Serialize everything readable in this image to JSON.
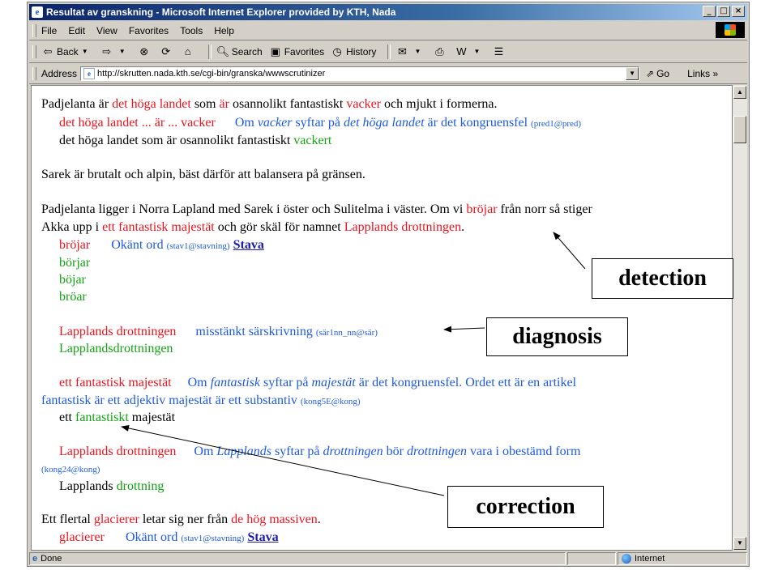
{
  "window": {
    "title": "Resultat av granskning - Microsoft Internet Explorer provided by KTH, Nada",
    "caption_buttons": [
      "_",
      "□",
      "×"
    ]
  },
  "menu": [
    "File",
    "Edit",
    "View",
    "Favorites",
    "Tools",
    "Help"
  ],
  "toolbar": {
    "back": "Back",
    "search": "Search",
    "favorites": "Favorites",
    "history": "History"
  },
  "address": {
    "label": "Address",
    "url": "http://skrutten.nada.kth.se/cgi-bin/granska/wwwscrutinizer",
    "go": "Go",
    "links": "Links"
  },
  "content": {
    "p1": {
      "a": "Padjelanta är ",
      "b": "det höga landet",
      "c": " som ",
      "d": "är",
      "e": " osannolikt fantastiskt ",
      "f": "vacker",
      "g": " och mjukt i formerna."
    },
    "p1_err": {
      "phrase": "det höga landet ... är ... vacker",
      "m1": "Om ",
      "m2": "vacker",
      "m3": " syftar på ",
      "m4": "det höga landet",
      "m5": " är det kongruensfel ",
      "code": "(pred1@pred)"
    },
    "p1_corr": {
      "a": "det höga landet som är osannolikt fantastiskt ",
      "b": "vackert"
    },
    "p2": "Sarek är brutalt och alpin, bäst därför att balansera på gränsen.",
    "p3": {
      "l1a": "Padjelanta ligger i Norra Lapland med Sarek i öster och Sulitelma i väster. Om vi ",
      "l1b": "bröjar",
      "l1c": " från norr så stiger",
      "l2a": "Akka upp i ",
      "l2b": "ett fantastisk majestät",
      "l2c": " och gör skäl för namnet ",
      "l2d": "Lapplands drottningen",
      "l2e": "."
    },
    "err_brojar": {
      "word": "bröjar",
      "msg": "Okänt ord ",
      "code": "(stav1@stavning)",
      "link": "Stava",
      "suggestions": [
        "börjar",
        "böjar",
        "bröar"
      ]
    },
    "err_sar": {
      "phrase": "Lapplands drottningen",
      "msg": "misstänkt särskrivning ",
      "code": "(sär1nn_nn@sär)",
      "fix": "Lapplandsdrottningen"
    },
    "err_kong": {
      "phrase": "ett fantastisk majestät",
      "m1": "Om ",
      "m2": "fantastisk",
      "m3": " syftar på ",
      "m4": "majestät",
      "m5": " är det kongruensfel. Ordet ett är en artikel",
      "l2": "fantastisk är ett adjektiv majestät är ett substantiv ",
      "code": "(kong5E@kong)",
      "fix_a": "ett ",
      "fix_b": "fantastiskt",
      "fix_c": " majestät"
    },
    "err_def": {
      "phrase": "Lapplands drottningen",
      "m1": "Om ",
      "m2": "Lapplands",
      "m3": " syftar på ",
      "m4": "drottningen",
      "m5": " bör ",
      "m6": "drottningen",
      "m7": " vara i obestämd form",
      "code": "(kong24@kong)",
      "fix_a": "Lapplands ",
      "fix_b": "drottning"
    },
    "p4": {
      "a": "Ett flertal ",
      "b": "glacierer",
      "c": " letar sig ner från ",
      "d": "de hög massiven",
      "e": "."
    },
    "err_glac": {
      "word": "glacierer",
      "msg": "Okänt ord ",
      "code": "(stav1@stavning)",
      "link": "Stava"
    }
  },
  "annotations": {
    "detection": "detection",
    "diagnosis": "diagnosis",
    "correction": "correction"
  },
  "status": {
    "left": "Done",
    "zone": "Internet"
  },
  "colors": {
    "error": "#e8141e",
    "correction": "#13a313",
    "message": "#1e5adc"
  }
}
